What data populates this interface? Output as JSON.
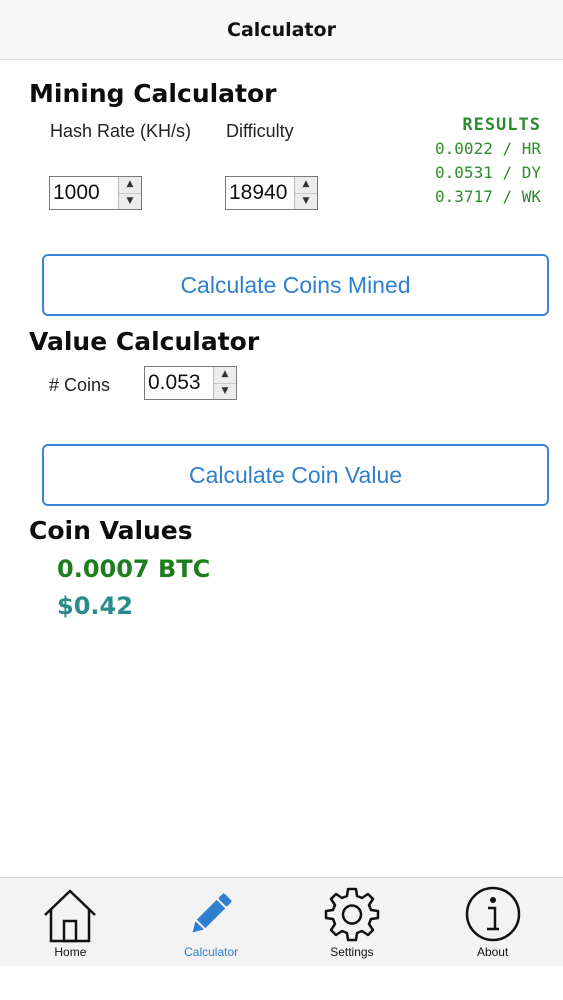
{
  "header": {
    "title": "Calculator"
  },
  "mining": {
    "title": "Mining Calculator",
    "hash_rate_label": "Hash Rate (KH/s)",
    "difficulty_label": "Difficulty",
    "hash_rate_value": "1000",
    "difficulty_value": "18940",
    "results": {
      "heading": "RESULTS",
      "hour": "0.0022 / HR",
      "day": "0.0531 / DY",
      "week": "0.3717 / WK"
    },
    "calculate_label": "Calculate Coins Mined"
  },
  "value": {
    "title": "Value Calculator",
    "coins_label": "# Coins",
    "coins_value": "0.053",
    "calculate_label": "Calculate Coin Value"
  },
  "coin_values": {
    "title": "Coin Values",
    "btc": "0.0007 BTC",
    "usd": "$0.42"
  },
  "nav": {
    "items": [
      {
        "label": "Home",
        "icon": "home-icon"
      },
      {
        "label": "Calculator",
        "icon": "pencil-icon",
        "active": true
      },
      {
        "label": "Settings",
        "icon": "gear-icon"
      },
      {
        "label": "About",
        "icon": "info-icon"
      }
    ]
  },
  "colors": {
    "accent": "#2f7fd1",
    "results_green": "#2e8b2e",
    "btc_green": "#1e7d1e",
    "usd_teal": "#2a8b8b"
  }
}
